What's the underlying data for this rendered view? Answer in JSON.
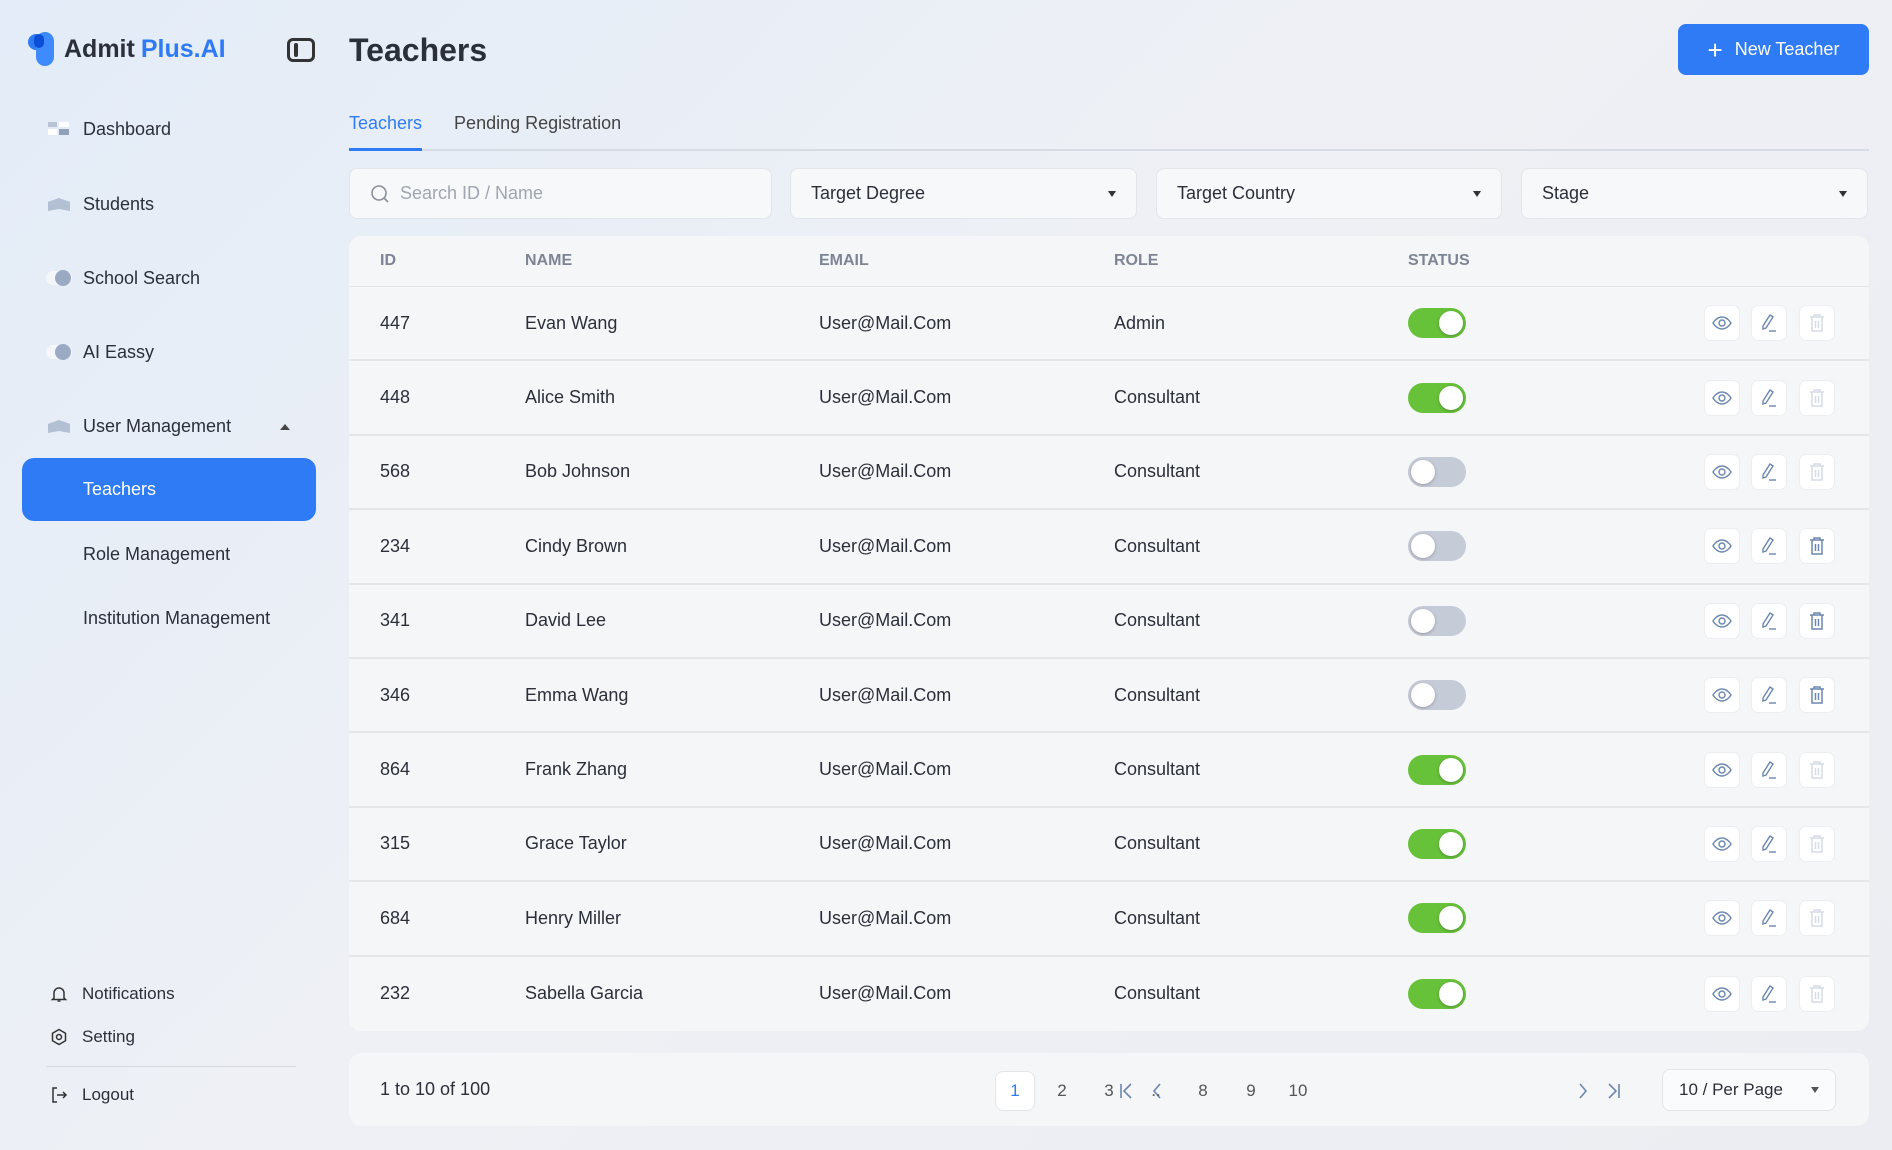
{
  "brand": {
    "name_part1": "Admit",
    "name_part2": "Plus.AI",
    "accent": "#2f7bf6"
  },
  "sidebar": {
    "items": [
      {
        "label": "Dashboard",
        "icon": "dashboard-icon"
      },
      {
        "label": "Students",
        "icon": "graduation-cap-icon"
      },
      {
        "label": "School Search",
        "icon": "toggle-circle-icon"
      },
      {
        "label": "AI Eassy",
        "icon": "toggle-circle-icon"
      },
      {
        "label": "User Management",
        "icon": "graduation-cap-icon",
        "expanded": true
      }
    ],
    "subitems": [
      {
        "label": "Teachers",
        "active": true
      },
      {
        "label": "Role Management",
        "active": false
      },
      {
        "label": "Institution Management",
        "active": false
      }
    ],
    "bottom": [
      {
        "label": "Notifications"
      },
      {
        "label": "Setting"
      },
      {
        "label": "Logout"
      }
    ]
  },
  "header": {
    "title": "Teachers",
    "new_button": "New Teacher"
  },
  "tabs": [
    {
      "label": "Teachers",
      "active": true
    },
    {
      "label": "Pending Registration",
      "active": false
    }
  ],
  "filters": {
    "search_placeholder": "Search ID / Name",
    "degree": "Target Degree",
    "country": "Target Country",
    "stage": "Stage"
  },
  "table": {
    "columns": [
      "ID",
      "NAME",
      "EMAIL",
      "ROLE",
      "STATUS"
    ],
    "rows": [
      {
        "id": "447",
        "name": "Evan Wang",
        "email": "User@Mail.Com",
        "role": "Admin",
        "active": true,
        "deletable": false
      },
      {
        "id": "448",
        "name": "Alice Smith",
        "email": "User@Mail.Com",
        "role": "Consultant",
        "active": true,
        "deletable": false
      },
      {
        "id": "568",
        "name": "Bob Johnson",
        "email": "User@Mail.Com",
        "role": "Consultant",
        "active": false,
        "deletable": false
      },
      {
        "id": "234",
        "name": "Cindy Brown",
        "email": "User@Mail.Com",
        "role": "Consultant",
        "active": false,
        "deletable": true
      },
      {
        "id": "341",
        "name": "David Lee",
        "email": "User@Mail.Com",
        "role": "Consultant",
        "active": false,
        "deletable": true
      },
      {
        "id": "346",
        "name": "Emma Wang",
        "email": "User@Mail.Com",
        "role": "Consultant",
        "active": false,
        "deletable": true
      },
      {
        "id": "864",
        "name": "Frank Zhang",
        "email": "User@Mail.Com",
        "role": "Consultant",
        "active": true,
        "deletable": false
      },
      {
        "id": "315",
        "name": "Grace Taylor",
        "email": "User@Mail.Com",
        "role": "Consultant",
        "active": true,
        "deletable": false
      },
      {
        "id": "684",
        "name": "Henry Miller",
        "email": "User@Mail.Com",
        "role": "Consultant",
        "active": true,
        "deletable": false
      },
      {
        "id": "232",
        "name": "Sabella Garcia",
        "email": "User@Mail.Com",
        "role": "Consultant",
        "active": true,
        "deletable": false
      }
    ]
  },
  "pagination": {
    "summary": "1 to 10 of 100",
    "pages": [
      "1",
      "2",
      "3",
      "..",
      "8",
      "9",
      "10"
    ],
    "current": "1",
    "per_page": "10 / Per Page"
  }
}
